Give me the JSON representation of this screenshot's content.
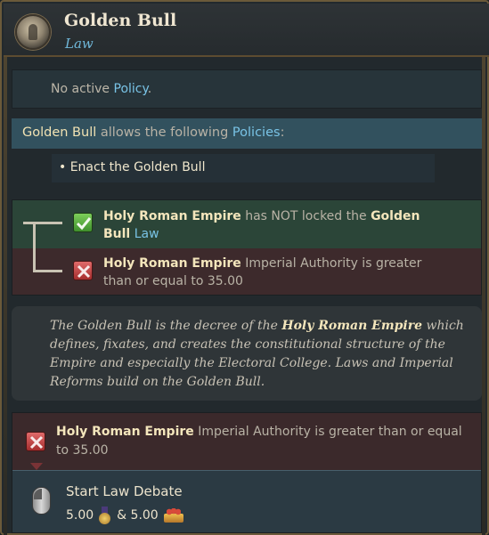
{
  "header": {
    "title": "Golden Bull",
    "subtitle": "Law"
  },
  "no_policy": {
    "prefix": "No active ",
    "link": "Policy",
    "suffix": "."
  },
  "allows": {
    "subject": "Golden Bull",
    "middle": " allows the following ",
    "link": "Policies",
    "suffix": ":"
  },
  "policies": [
    "• Enact the Golden Bull"
  ],
  "conditions": [
    {
      "status": "met",
      "subject": "Holy Roman Empire",
      "text": " has NOT locked the ",
      "object": "Golden Bull",
      "link": "Law"
    },
    {
      "status": "unmet",
      "subject": "Holy Roman Empire",
      "text": " Imperial Authority is greater than or equal to 35.00"
    }
  ],
  "description": {
    "part1": "The Golden Bull is the decree of the ",
    "emphasis": "Holy Roman Empire",
    "part2": " which defines, fixates, and creates the constitutional structure of the Empire and especially the Electoral College. Laws and Imperial Reforms build on the Golden Bull."
  },
  "requirement": {
    "subject": "Holy Roman Empire",
    "text": " Imperial Authority is greater than or equal to 35.00"
  },
  "action": {
    "label": "Start Law Debate",
    "cost1": "5.00",
    "joiner": "& 5.00"
  },
  "icons": {
    "emblem": "imperial-emblem-icon",
    "check": "check-icon",
    "cross": "cross-icon",
    "mouse": "mouse-left-click-icon",
    "medal": "prestige-medal-icon",
    "crown": "crown-icon"
  },
  "colors": {
    "accent_gold": "#f2e3b3",
    "link_blue": "#79c3e6",
    "met_bg": "#2b4538",
    "unmet_bg": "#3d2a2c"
  }
}
